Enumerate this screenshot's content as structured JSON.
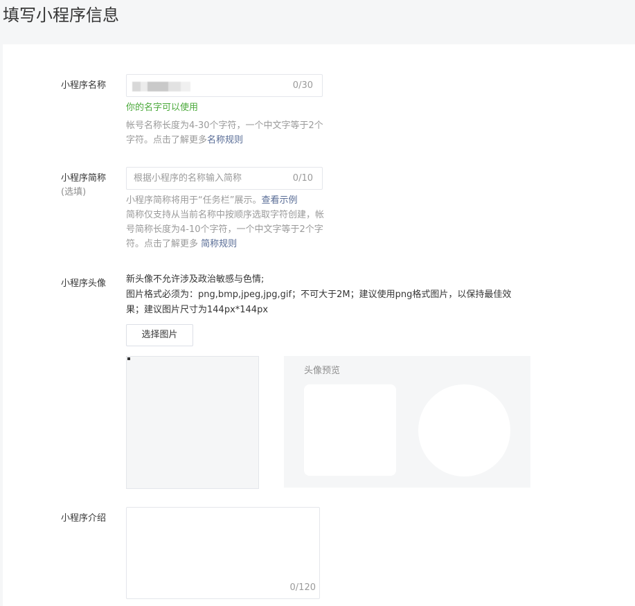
{
  "page": {
    "title": "填写小程序信息"
  },
  "name_field": {
    "label": "小程序名称",
    "counter": "0/30",
    "status": "你的名字可以使用",
    "hint": "帐号名称长度为4-30个字符，一个中文字等于2个字符。点击了解更多",
    "hint_link": "名称规则"
  },
  "short_name_field": {
    "label": "小程序简称",
    "label_sub": "(选填)",
    "placeholder": "根据小程序的名称输入简称",
    "counter": "0/10",
    "hint_line1": "小程序简称将用于“任务栏”展示。",
    "hint_line1_link": "查看示例",
    "hint_rest": "简称仅支持从当前名称中按顺序选取字符创建，帐号简称长度为4-10个字符，一个中文字等于2个字符。点击了解更多 ",
    "hint_rest_link": "简称规则"
  },
  "avatar_field": {
    "label": "小程序头像",
    "desc_line1": "新头像不允许涉及政治敏感与色情;",
    "desc_line2": "图片格式必须为：png,bmp,jpeg,jpg,gif；不可大于2M；建议使用png格式图片，以保持最佳效果；建议图片尺寸为144px*144px",
    "select_button": "选择图片",
    "preview_title": "头像预览"
  },
  "intro_field": {
    "label": "小程序介绍",
    "counter": "0/120"
  },
  "colors": {
    "success": "#4aa93a",
    "link": "#576b95",
    "hint": "#9a9a9a"
  }
}
